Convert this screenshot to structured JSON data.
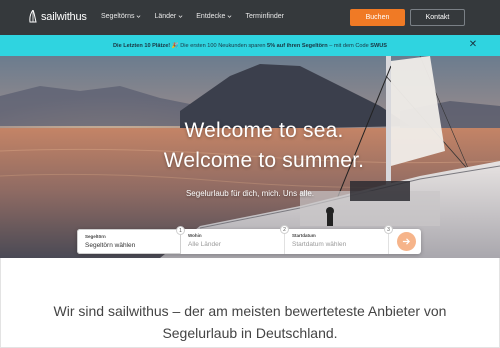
{
  "nav": {
    "logo_text": "sailwithus",
    "links": [
      {
        "label": "Segeltörns"
      },
      {
        "label": "Länder"
      },
      {
        "label": "Entdecke"
      },
      {
        "label": "Terminfinder"
      }
    ],
    "buchen_label": "Buchen",
    "kontakt_label": "Kontakt"
  },
  "promo": {
    "bold_prefix": "Die Letzten 10 Plätze!",
    "emoji": "🎉",
    "text_mid": " Die ersten 100 Neukunden sparen ",
    "bold_offer": "5% auf ihren Segeltörn",
    "text_end": " – mit dem Code ",
    "code": "SWUS",
    "close": "✕"
  },
  "hero": {
    "title_line1": "Welcome to sea.",
    "title_line2": "Welcome to summer.",
    "subtitle": "Segelurlaub für dich, mich. Uns alle."
  },
  "search": {
    "fields": [
      {
        "label": "Segeltörn",
        "value": "Segeltörn wählen",
        "number": "1"
      },
      {
        "label": "Wohin",
        "value": "Alle Länder",
        "number": "2"
      },
      {
        "label": "Startdatum",
        "value": "Startdatum wählen",
        "number": "3"
      }
    ]
  },
  "main": {
    "headline_line1": "Wir sind sailwithus – der am meisten bewerteteste Anbieter von",
    "headline_line2": "Segelurlaub in Deutschland."
  },
  "colors": {
    "nav_bg": "#35393c",
    "accent_orange": "#f07a25",
    "promo_cyan": "#2fd4e0"
  }
}
